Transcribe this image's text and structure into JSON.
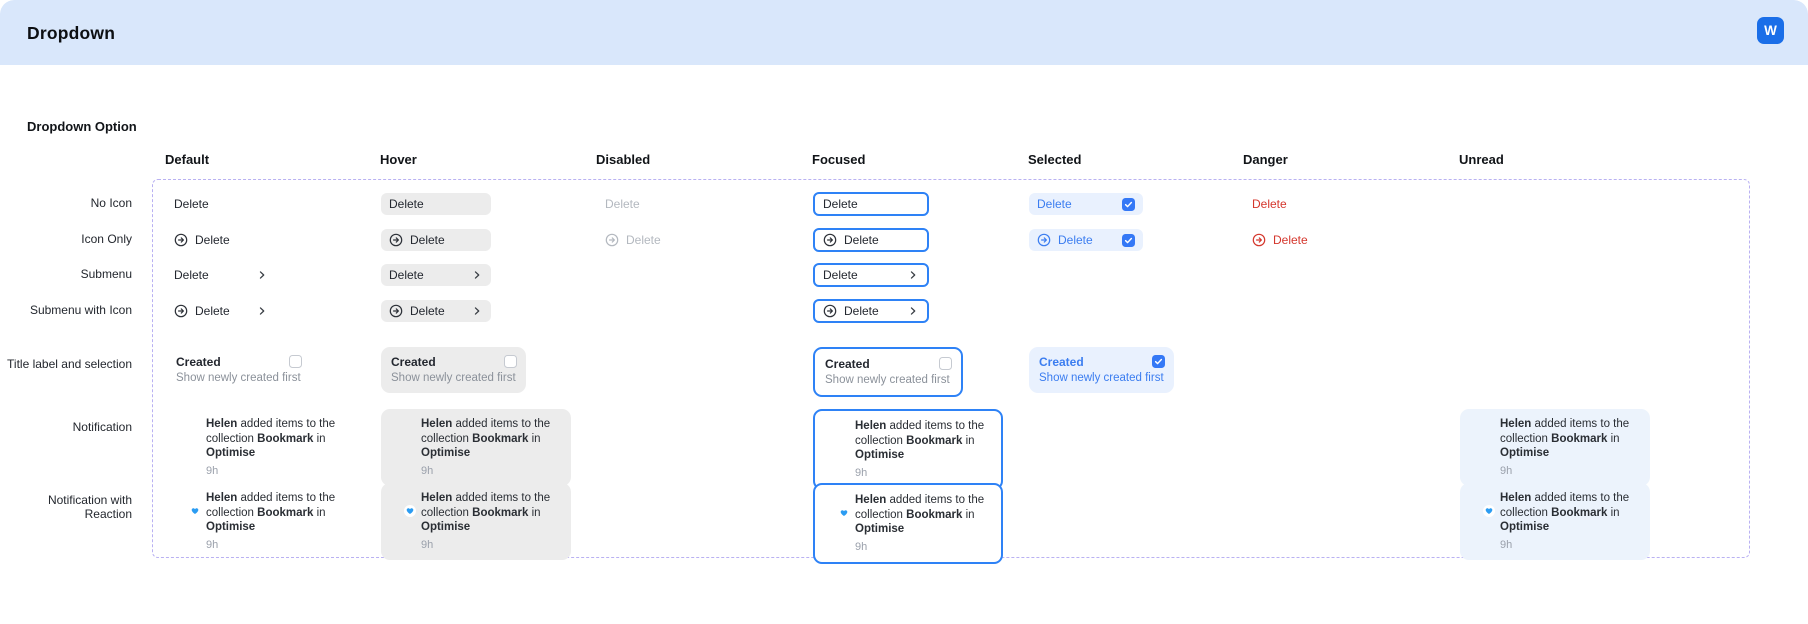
{
  "header": {
    "title": "Dropdown",
    "logo_letter": "W"
  },
  "section": {
    "label": "Dropdown Option"
  },
  "columns": {
    "default": "Default",
    "hover": "Hover",
    "disabled": "Disabled",
    "focused": "Focused",
    "selected": "Selected",
    "danger": "Danger",
    "unread": "Unread"
  },
  "rows": {
    "no_icon": "No Icon",
    "icon_only": "Icon Only",
    "submenu": "Submenu",
    "submenu_icon": "Submenu with Icon",
    "title_selection": "Title label and selection",
    "notification": "Notification",
    "notification_reaction": "Notification with Reaction"
  },
  "menu_item": {
    "label": "Delete"
  },
  "title_option": {
    "title": "Created",
    "subtitle": "Show newly created first"
  },
  "notification": {
    "name": "Helen",
    "line1_rest": " added items to the ",
    "line2_pre": "collection ",
    "collection": "Bookmark",
    "line2_mid": " in ",
    "workspace": "Optimise",
    "time": "9h"
  },
  "colors": {
    "header_band": "#d9e7fb",
    "logo_blue": "#1a6ee8",
    "focus_border": "#2e82f6",
    "selected_bg": "#e9f1fe",
    "selected_text": "#3b7df0",
    "checkbox_blue": "#3478f6",
    "danger_red": "#d4362c",
    "hover_gray": "#ececec",
    "unread_bg": "#ecf3fc",
    "dashed_border": "#b9b1f2",
    "reaction_blue": "#2b9cf2"
  }
}
